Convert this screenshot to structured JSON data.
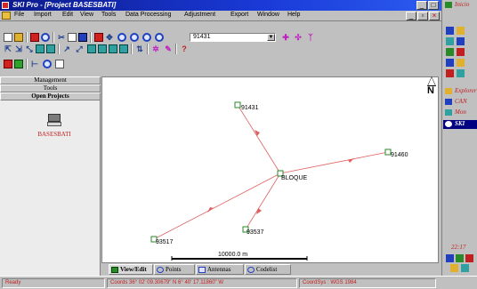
{
  "window": {
    "title": "SKI Pro - [Project BASESBATI]"
  },
  "menu": {
    "items": [
      "File",
      "Import",
      "Edit",
      "View",
      "Tools",
      "Data Processing",
      "Adjustment",
      "Export",
      "Window",
      "Help"
    ]
  },
  "toolbar": {
    "point_select_value": "91431"
  },
  "left_panel": {
    "tabs": [
      "Management",
      "Tools",
      "Open Projects"
    ],
    "project_name": "BASESBATI"
  },
  "map": {
    "north_label": "N",
    "points": [
      "91431",
      "BLOQUE",
      "91460",
      "93537",
      "93517"
    ],
    "scale_label": "10000.0 m"
  },
  "view_tabs": [
    "View/Edit",
    "Points",
    "Antennas",
    "Codelist"
  ],
  "right_panel": {
    "buttons": [
      "Inicio",
      "Explorer",
      "CAN",
      "Mon",
      "SKI"
    ],
    "clock": "22:17"
  },
  "status": {
    "left": "Ready",
    "coords": "Coords  36° 02' 09.30679\" N   6° 40' 17.11860\" W",
    "cond": "CoordSys : WGS 1984"
  },
  "colors": {
    "title_bar": "#1a3ad8",
    "baseline": "#e06060",
    "point_marker": "#2a8a2a",
    "status_text": "#c02020"
  },
  "icons": {
    "north": "north-arrow-icon",
    "project": "computer-icon"
  }
}
